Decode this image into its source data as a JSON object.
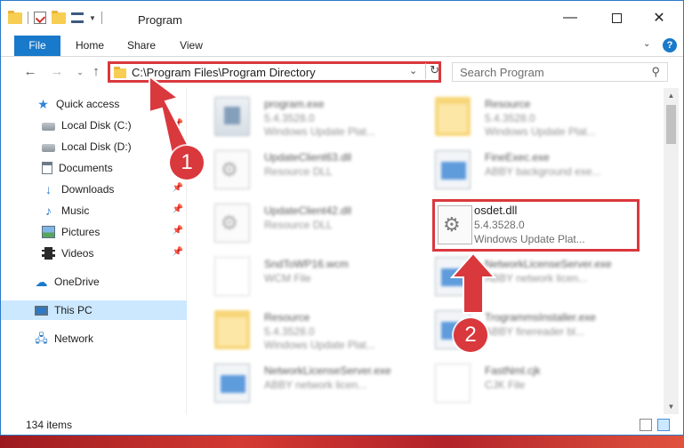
{
  "window": {
    "title": "Program"
  },
  "ribbon": {
    "tabs": [
      "File",
      "Home",
      "Share",
      "View"
    ]
  },
  "nav": {
    "address": "C:\\Program Files\\Program Directory",
    "search_placeholder": "Search Program"
  },
  "sidebar": {
    "items": [
      {
        "label": "Quick access",
        "icon": "star-icon",
        "pinned": false
      },
      {
        "label": "Local Disk (C:)",
        "icon": "disk-icon",
        "pinned": true
      },
      {
        "label": "Local Disk (D:)",
        "icon": "disk-icon",
        "pinned": false
      },
      {
        "label": "Documents",
        "icon": "documents-icon",
        "pinned": false
      },
      {
        "label": "Downloads",
        "icon": "download-icon",
        "pinned": true
      },
      {
        "label": "Music",
        "icon": "music-icon",
        "pinned": true
      },
      {
        "label": "Pictures",
        "icon": "pictures-icon",
        "pinned": true
      },
      {
        "label": "Videos",
        "icon": "videos-icon",
        "pinned": true
      },
      {
        "label": "OneDrive",
        "icon": "cloud-icon",
        "pinned": false
      },
      {
        "label": "This PC",
        "icon": "computer-icon",
        "pinned": false,
        "selected": true
      },
      {
        "label": "Network",
        "icon": "network-icon",
        "pinned": false
      }
    ]
  },
  "files": [
    {
      "name": "program.exe",
      "line1": "5.4.3528.0",
      "line2": "Windows Update Plat...",
      "type": "exe"
    },
    {
      "name": "Resource",
      "line1": "5.4.3528.0",
      "line2": "Windows Update Plat...",
      "type": "folder"
    },
    {
      "name": "UpdateClient63.dll",
      "line1": "Resource DLL",
      "line2": "",
      "type": "dll"
    },
    {
      "name": "FineExec.exe",
      "line1": "ABBY background exe...",
      "line2": "",
      "type": "app"
    },
    {
      "name": "UpdateClient42.dll",
      "line1": "Resource DLL",
      "line2": "",
      "type": "dll"
    },
    {
      "name": "NetworkLicenseServer.exe",
      "line1": "ABBY network licen...",
      "line2": "",
      "type": "app"
    },
    {
      "name": "SndToWP16.wcm",
      "line1": "WCM File",
      "line2": "",
      "type": "blank"
    },
    {
      "name": "Resource",
      "line1": "5.4.3528.0",
      "line2": "Windows Update Plat...",
      "type": "folder"
    },
    {
      "name": "TrogrammsInstaller.exe",
      "line1": "ABBY finereader bl...",
      "line2": "",
      "type": "app"
    },
    {
      "name": "NetworkLicenseServer.exe",
      "line1": "ABBY network licen...",
      "line2": "",
      "type": "app"
    },
    {
      "name": "FastNml.cjk",
      "line1": "CJK File",
      "line2": "",
      "type": "blank"
    }
  ],
  "highlighted_file": {
    "name": "osdet.dll",
    "line1": "5.4.3528.0",
    "line2": "Windows Update Plat..."
  },
  "status": {
    "items": "134 items"
  },
  "annotations": {
    "step1": "1",
    "step2": "2",
    "color": "#d9383d"
  }
}
